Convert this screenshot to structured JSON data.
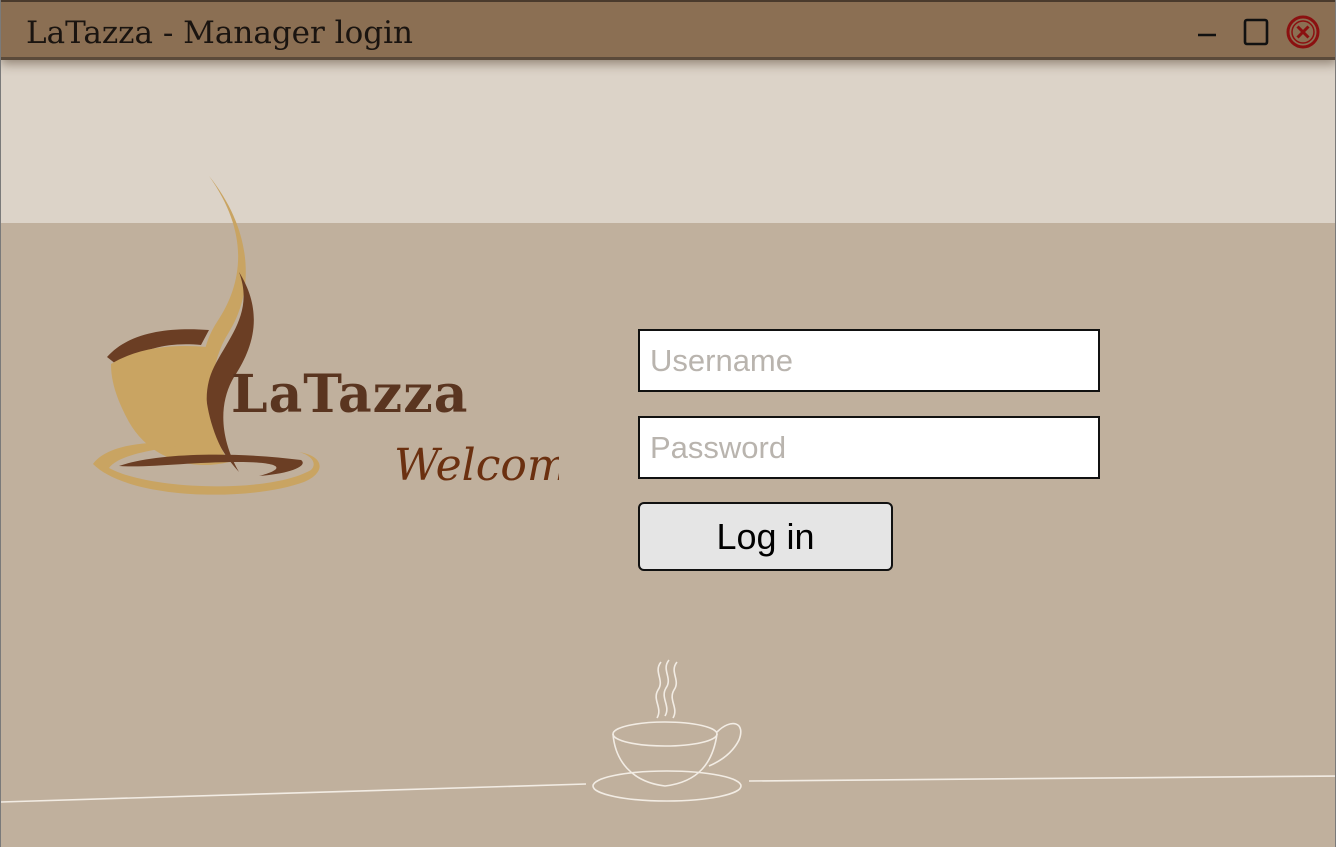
{
  "window": {
    "title": "LaTazza - Manager login",
    "controls": {
      "minimize_icon": "minimize-icon",
      "maximize_icon": "maximize-icon",
      "close_icon": "close-circle-x-icon"
    }
  },
  "logo": {
    "brand": "LaTazza",
    "tagline": "Welcome",
    "icon": "coffee-cup-logo"
  },
  "form": {
    "username_placeholder": "Username",
    "username_value": "",
    "password_placeholder": "Password",
    "password_value": "",
    "login_label": "Log in"
  },
  "colors": {
    "titlebar": "#8b6f53",
    "header_band": "#dcd3c8",
    "background": "#c0b09d",
    "brand_dark": "#5a3520",
    "brand_gold": "#c9a462",
    "close_red": "#8b1010"
  }
}
